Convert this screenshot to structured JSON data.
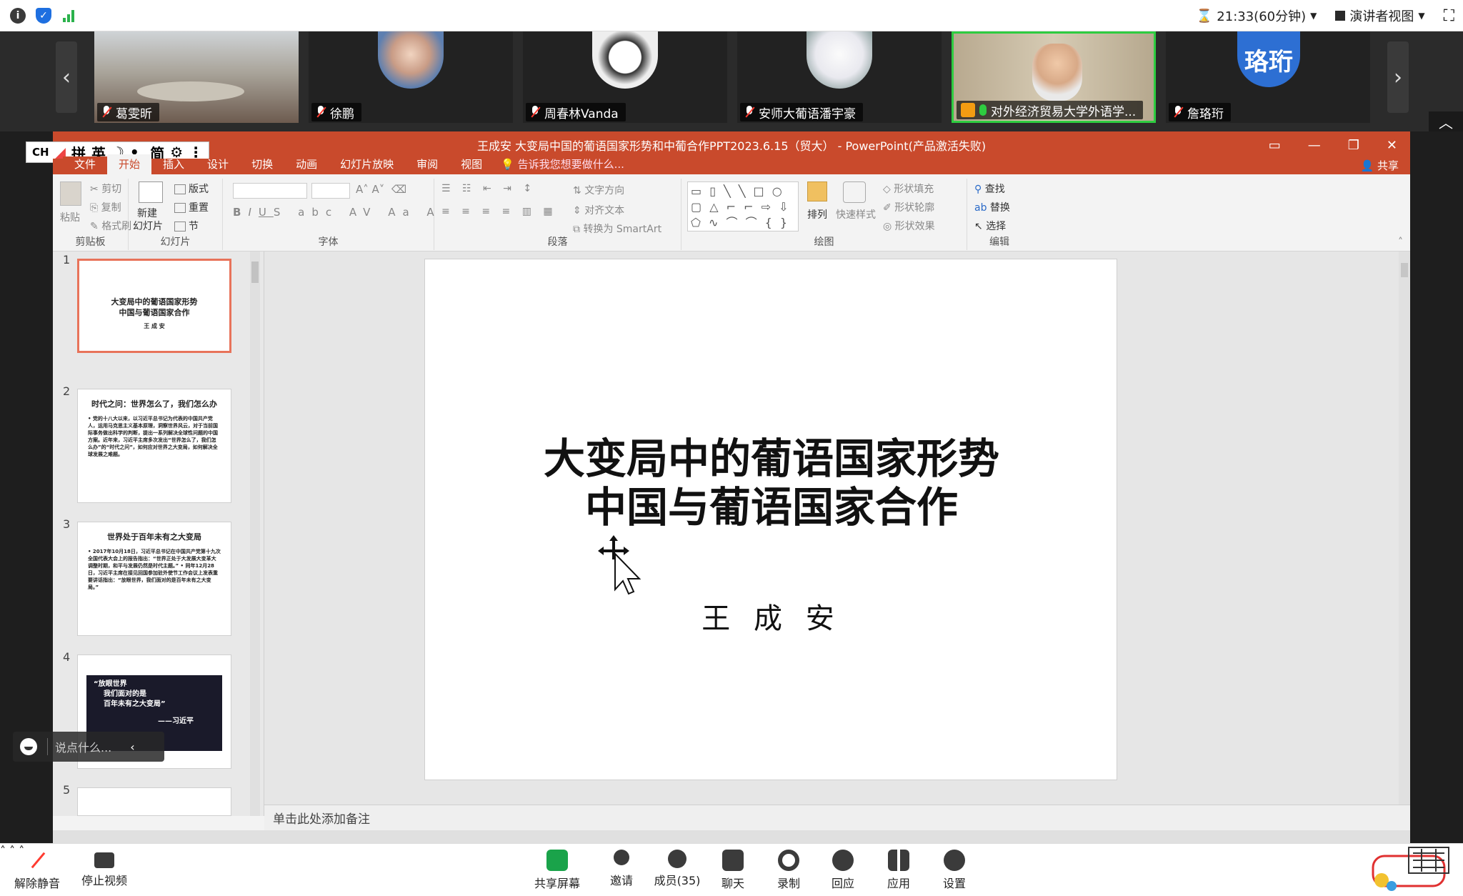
{
  "topbar": {
    "timer": "21:33(60分钟)",
    "view_mode": "演讲者视图",
    "colors": {
      "info": "#3a3a3a",
      "shield": "#1e6fe0",
      "signal": "#2bb24c"
    }
  },
  "participants": [
    {
      "name": "葛雯昕",
      "muted": true
    },
    {
      "name": "徐鹏",
      "muted": true
    },
    {
      "name": "周春林Vanda",
      "muted": true
    },
    {
      "name": "安师大葡语潘宇豪",
      "muted": true
    },
    {
      "name": "对外经济贸易大学外语学...",
      "muted": false,
      "speaking": true
    },
    {
      "name": "詹珞珩",
      "muted": true,
      "avatar_text": "珞珩"
    }
  ],
  "ppt": {
    "window_title": "王成安 大变局中国的葡语国家形势和中葡合作PPT2023.6.15（贸大） - PowerPoint(产品激活失败)",
    "ime": {
      "lang": "CH",
      "mode": "拼",
      "punct": "英",
      "simplified": "简"
    },
    "tabs": [
      "文件",
      "开始",
      "插入",
      "设计",
      "切换",
      "动画",
      "幻灯片放映",
      "审阅",
      "视图"
    ],
    "active_tab": "开始",
    "tell_me": "告诉我您想要做什么...",
    "share": "共享",
    "ribbon": {
      "clipboard": {
        "label": "剪贴板",
        "paste": "粘贴",
        "cut": "剪切",
        "copy": "复制",
        "format_painter": "格式刷"
      },
      "slides": {
        "label": "幻灯片",
        "new_slide": "新建",
        "new_slide2": "幻灯片",
        "layout": "版式",
        "reset": "重置",
        "section": "节"
      },
      "font": {
        "label": "字体"
      },
      "paragraph": {
        "label": "段落",
        "text_direction": "文字方向",
        "align_text": "对齐文本",
        "smartart": "转换为 SmartArt"
      },
      "drawing": {
        "label": "绘图",
        "arrange": "排列",
        "quick_styles": "快速样式",
        "fill": "形状填充",
        "outline": "形状轮廓",
        "effects": "形状效果"
      },
      "editing": {
        "label": "编辑",
        "find": "查找",
        "replace": "替换",
        "select": "选择"
      }
    },
    "thumbnails": [
      {
        "num": "1",
        "title1": "大变局中的葡语国家形势",
        "title2": "中国与葡语国家合作",
        "sub": "王 成 安"
      },
      {
        "num": "2",
        "heading": "时代之问：世界怎么了，我们怎么办",
        "body": "• 党的十八大以来，以习近平总书记为代表的中国共产党人，运用马克思主义基本原理，洞察世界风云，对于当前国际事务做出科学的判断，提出一系列解决全球性问题的中国方案。近年来，习近平主席多次发出“世界怎么了，我们怎么办”的“时代之问”，如何应对世界之大变局，如何解决全球发展之难题。"
      },
      {
        "num": "3",
        "heading": "世界处于百年未有之大变局",
        "body": "• 2017年10月18日，习近平总书记在中国共产党第十九次全国代表大会上的报告指出：“世界正处于大发展大变革大调整时期，和平与发展仍然是时代主题。” • 同年12月28日，习近平主席在接见回国参加驻外使节工作会议上发表重要讲话指出：“放眼世界，我们面对的是百年未有之大变局。”"
      },
      {
        "num": "4",
        "quote1": "“放眼世界",
        "quote2": "我们面对的是",
        "quote3": "百年未有之大变局”",
        "quote4": "——习近平"
      },
      {
        "num": "5"
      }
    ],
    "slide": {
      "title_line1": "大变局中的葡语国家形势",
      "title_line2": "中国与葡语国家合作",
      "author": "王 成 安"
    },
    "notes_placeholder": "单击此处添加备注"
  },
  "chat": {
    "placeholder": "说点什么..."
  },
  "toolbar": {
    "unmute": "解除静音",
    "stop_video": "停止视频",
    "share_screen": "共享屏幕",
    "invite": "邀请",
    "members": "成员(35)",
    "chat": "聊天",
    "record": "录制",
    "reactions": "回应",
    "apps": "应用",
    "settings": "设置"
  }
}
